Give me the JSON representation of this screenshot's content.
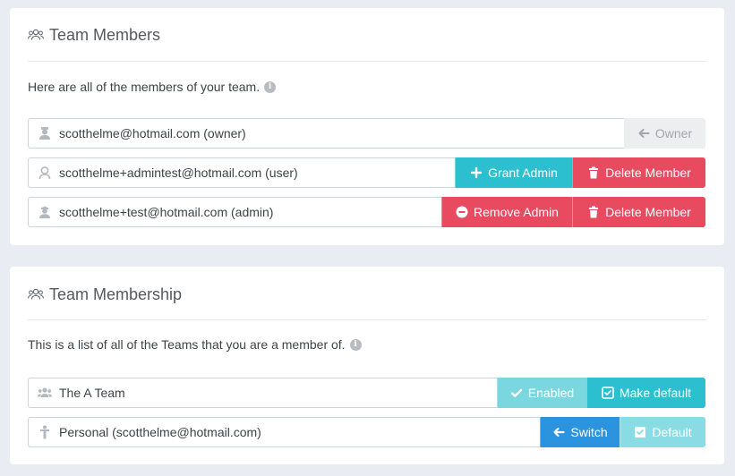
{
  "team_members": {
    "title": "Team Members",
    "intro": "Here are all of the members of your team.",
    "members": [
      {
        "email": "scotthelme@hotmail.com (owner)",
        "icon": "owner-user-icon",
        "actions": [
          {
            "label": "Owner",
            "icon": "arrow-left-icon"
          }
        ]
      },
      {
        "email": "scotthelme+admintest@hotmail.com (user)",
        "icon": "user-icon",
        "actions": [
          {
            "label": "Grant Admin",
            "icon": "plus-icon"
          },
          {
            "label": "Delete Member",
            "icon": "trash-icon"
          }
        ]
      },
      {
        "email": "scotthelme+test@hotmail.com (admin)",
        "icon": "admin-user-icon",
        "actions": [
          {
            "label": "Remove Admin",
            "icon": "minus-circle-icon"
          },
          {
            "label": "Delete Member",
            "icon": "trash-icon"
          }
        ]
      }
    ]
  },
  "team_membership": {
    "title": "Team Membership",
    "intro": "This is a list of all of the Teams that you are a member of.",
    "teams": [
      {
        "name": "The A Team",
        "icon": "users-icon",
        "actions": [
          {
            "label": "Enabled",
            "icon": "check-icon"
          },
          {
            "label": "Make default",
            "icon": "checkbox-icon"
          }
        ]
      },
      {
        "name": "Personal (scotthelme@hotmail.com)",
        "icon": "person-icon",
        "actions": [
          {
            "label": "Switch",
            "icon": "arrow-left-icon"
          },
          {
            "label": "Default",
            "icon": "checkbox-checked-icon"
          }
        ]
      }
    ]
  },
  "colors": {
    "teal": "#2cbfd0",
    "red": "#e84a5f",
    "blue": "#2c93de",
    "gray_button": "#eceef0",
    "page_background": "#e9ecf2"
  }
}
